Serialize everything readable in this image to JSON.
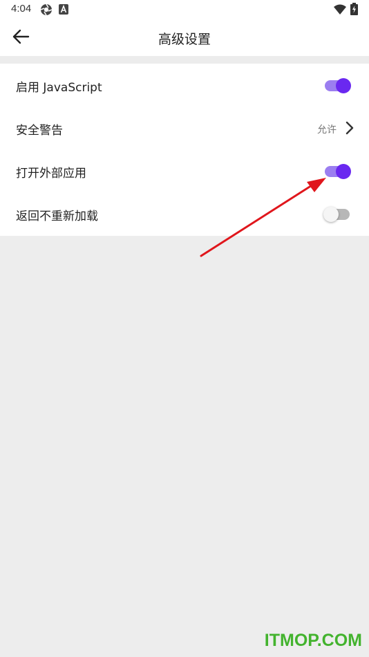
{
  "status_bar": {
    "time": "4:04",
    "icons": [
      "aperture-icon",
      "a-badge-icon",
      "wifi-icon",
      "battery-icon"
    ]
  },
  "app_bar": {
    "title": "高级设置",
    "back_icon": "arrow-left-icon"
  },
  "settings": [
    {
      "label": "启用 JavaScript",
      "control": "toggle",
      "on": true
    },
    {
      "label": "安全警告",
      "control": "link",
      "value": "允许"
    },
    {
      "label": "打开外部应用",
      "control": "toggle",
      "on": true
    },
    {
      "label": "返回不重新加载",
      "control": "toggle",
      "on": false
    }
  ],
  "colors": {
    "accent": "#6a28f0",
    "accent_track": "#9b7ef0",
    "off_track": "#b7b7b7",
    "background": "#ededed",
    "annotation_arrow": "#e0161c",
    "watermark": "#43b32e"
  },
  "watermark": "ITMOP.COM"
}
